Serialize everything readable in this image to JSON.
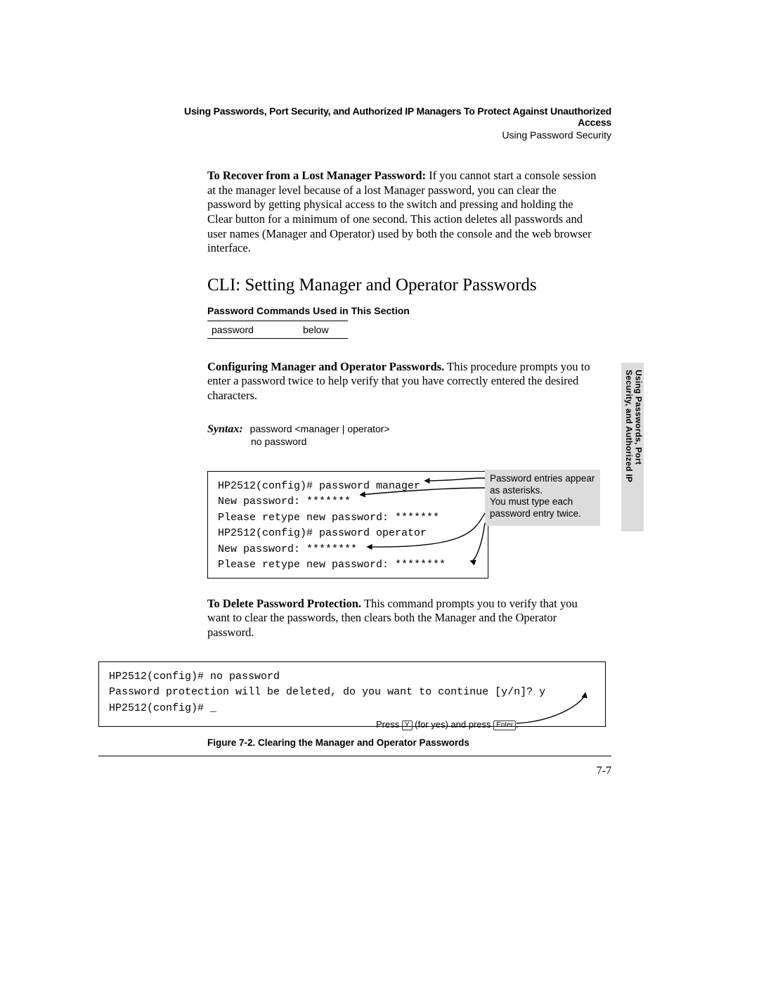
{
  "header": {
    "line1": "Using Passwords, Port Security, and Authorized IP Managers To Protect Against Unauthorized Access",
    "line2": "Using Password Security"
  },
  "para_recover_bold": "To Recover from a Lost Manager Password:",
  "para_recover_rest": "  If you cannot start a console session at the manager level because of a lost Manager password, you can clear the password by getting physical access to the switch and pressing and holding the Clear button for a minimum of one second. This action deletes all passwords and user names (Manager and Operator) used by both the console and the web browser interface.",
  "h2": "CLI: Setting Manager and Operator Passwords",
  "table_title": "Password Commands Used in This Section",
  "cmd_row": {
    "c1": "password",
    "c2": "below"
  },
  "para_config_bold": "Configuring Manager and Operator Passwords.",
  "para_config_rest": "  This procedure prompts you to enter a password twice to help verify that you have correctly entered the desired characters.",
  "syntax": {
    "label": "Syntax:",
    "line1": "password <manager | operator>",
    "line2": "no password"
  },
  "terminal1": {
    "l1": "HP2512(config)# password manager",
    "l2": "New password: *******",
    "l3": "Please retype new password: *******",
    "l4": "HP2512(config)# password operator",
    "l5": "New password: ********",
    "l6": "Please retype new password: ********"
  },
  "callout": {
    "l1": "Password entries appear as asterisks.",
    "l2": "You must type each password entry twice."
  },
  "para_delete_bold": "To Delete Password Protection.",
  "para_delete_rest": "  This command prompts you to verify that you want to clear the passwords, then clears both the Manager and the Operator password.",
  "terminal2": {
    "l1": "HP2512(config)# no password",
    "l2": "Password protection will be deleted, do you want to continue [y/n]? y",
    "l3": "HP2512(config)# _"
  },
  "keyhint": {
    "pre": "Press ",
    "k1": "Y",
    "mid": " (for yes) and press ",
    "k2": "Enter",
    "post": "."
  },
  "caption": "Figure 7-2.   Clearing the Manager and Operator Passwords",
  "sidetab": {
    "l1": "Using Passwords, Port",
    "l2": "Security, and Authorized IP"
  },
  "page_num": "7-7"
}
